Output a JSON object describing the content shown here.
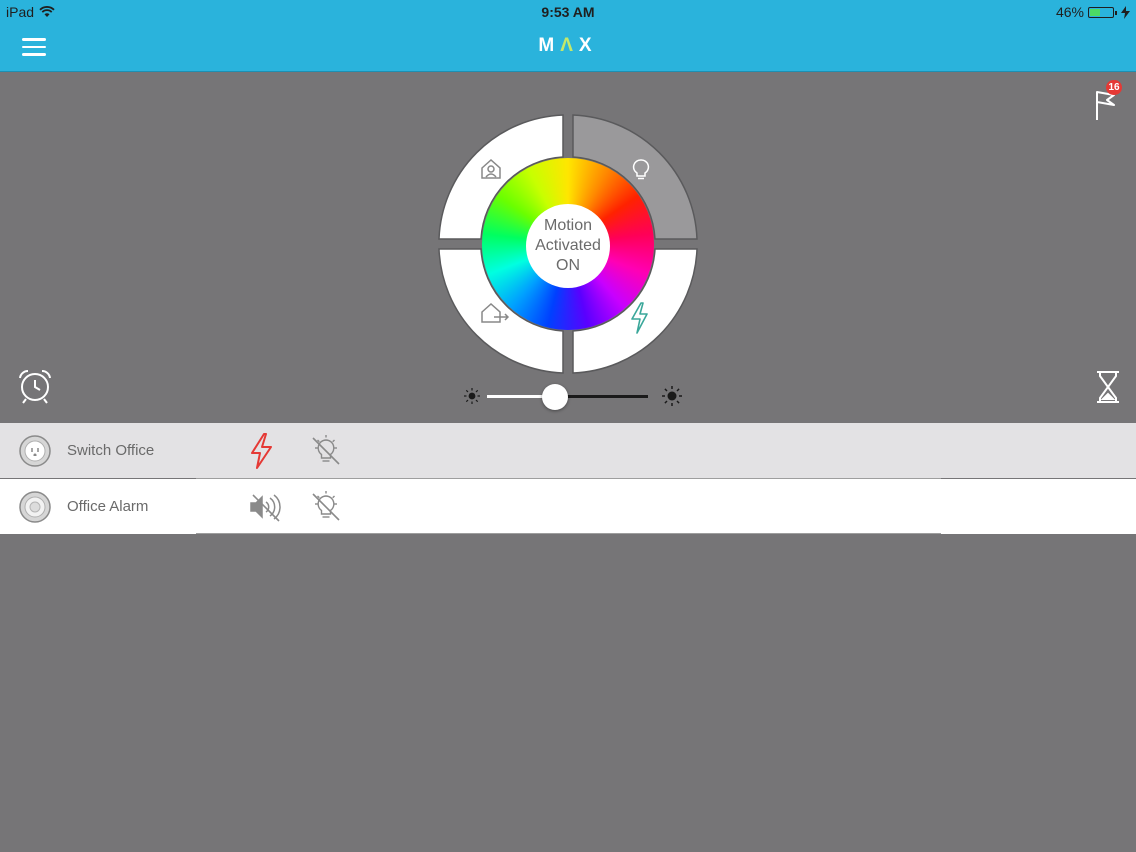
{
  "status_bar": {
    "device": "iPad",
    "time": "9:53 AM",
    "battery": "46%",
    "battery_level": 0.46,
    "icons": [
      "wifi-icon",
      "battery-icon",
      "charging-bolt-icon"
    ]
  },
  "nav": {
    "logo_part1": "M",
    "logo_part2": "Λ",
    "logo_part3": "X",
    "menu_icon": "hamburger-menu-icon"
  },
  "notifications": {
    "count": "16",
    "icon": "flag-icon"
  },
  "mode_wheel": {
    "center_lines": [
      "Motion",
      "Activated",
      "ON"
    ],
    "quadrants": [
      {
        "name": "home-mode",
        "icon": "home-person-icon",
        "selected": false
      },
      {
        "name": "light-mode",
        "icon": "lightbulb-icon",
        "selected": true
      },
      {
        "name": "away-mode",
        "icon": "house-leave-icon",
        "selected": false
      },
      {
        "name": "energy-mode",
        "icon": "lightning-bolt-icon",
        "selected": false
      }
    ],
    "colors": {
      "selected": "#9a999b",
      "unselected": "#ffffff"
    }
  },
  "brightness": {
    "level": 0.42,
    "icons": [
      "sun-small-icon",
      "sun-large-icon"
    ]
  },
  "side_icons": {
    "left": "alarm-clock-icon",
    "right": "hourglass-icon"
  },
  "devices": [
    {
      "name": "Switch Office",
      "action1_icon": "lightning-bolt-icon",
      "action1_color": "#e53935",
      "action2_icon": "lightbulb-off-icon"
    },
    {
      "name": "Office Alarm",
      "action1_icon": "speaker-muted-icon",
      "action1_color": "#8a8a8a",
      "action2_icon": "lightbulb-off-icon"
    }
  ],
  "colors": {
    "header": "#2ab3dc",
    "background": "#767577",
    "accent_logo": "#c4e86a",
    "badge": "#e53935"
  }
}
